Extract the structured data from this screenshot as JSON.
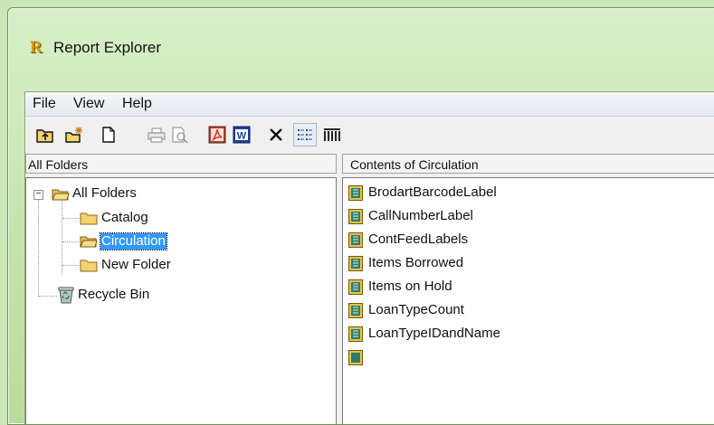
{
  "window": {
    "title": "Report Explorer",
    "app_icon_glyph": "R"
  },
  "menu": [
    "File",
    "View",
    "Help"
  ],
  "toolbar": {
    "buttons": [
      {
        "icon": "up-folder-icon"
      },
      {
        "icon": "new-folder-icon"
      },
      {
        "icon": "new-report-icon"
      },
      {
        "icon": "print-icon"
      },
      {
        "icon": "print-preview-icon"
      },
      {
        "icon": "pdf-export-icon"
      },
      {
        "icon": "word-export-icon",
        "glyph": "W"
      },
      {
        "icon": "delete-icon",
        "glyph": "✕"
      },
      {
        "icon": "list-view-icon"
      },
      {
        "icon": "details-view-icon"
      }
    ]
  },
  "left_panel": {
    "header": "All Folders",
    "tree": {
      "root": "All Folders",
      "children": [
        "Catalog",
        "Circulation",
        "New Folder"
      ],
      "selected": "Circulation",
      "recycle": "Recycle Bin"
    }
  },
  "right_panel": {
    "header": "Contents of Circulation",
    "items": [
      "BrodartBarcodeLabel",
      "CallNumberLabel",
      "ContFeedLabels",
      "Items Borrowed",
      "Items on Hold",
      "LoanTypeCount",
      "LoanTypeIDandName"
    ]
  },
  "colors": {
    "selection": "#3399ff",
    "frame_green": "#c3e3aa",
    "pdf_red": "#d23a1e",
    "word_blue": "#1d3f9a",
    "report_icon": "#2e7d6b"
  }
}
